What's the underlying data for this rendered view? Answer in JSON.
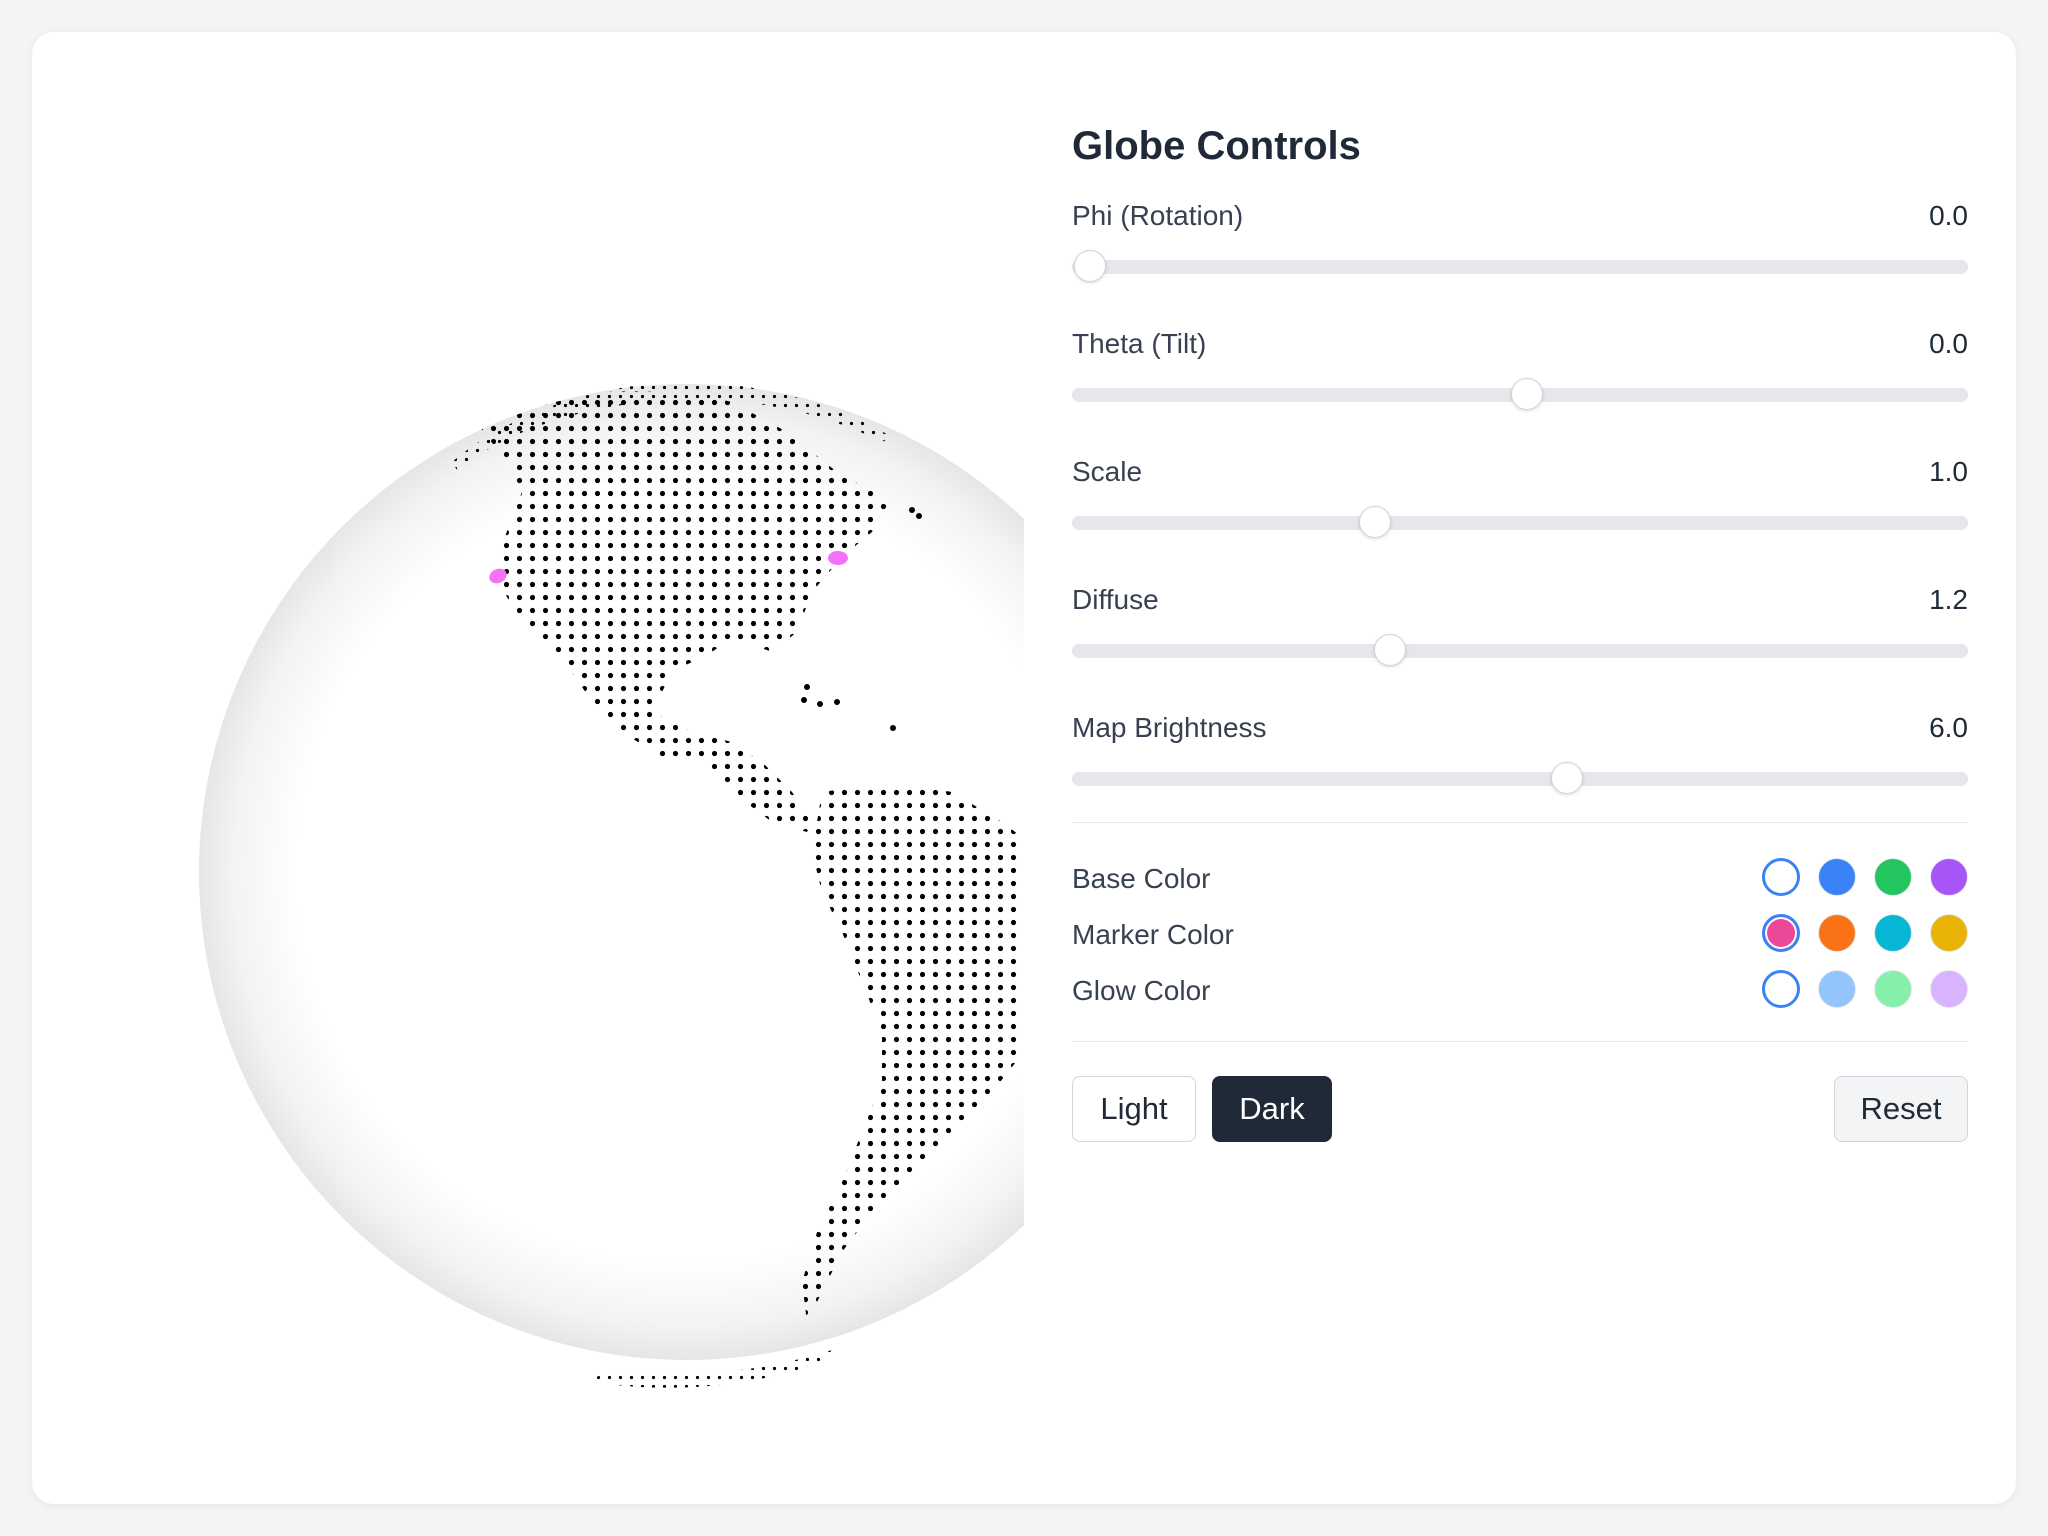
{
  "panel": {
    "title": "Globe Controls"
  },
  "sliders": [
    {
      "label": "Phi (Rotation)",
      "value": "0.0",
      "position": 0.02
    },
    {
      "label": "Theta (Tilt)",
      "value": "0.0",
      "position": 0.508
    },
    {
      "label": "Scale",
      "value": "1.0",
      "position": 0.338
    },
    {
      "label": "Diffuse",
      "value": "1.2",
      "position": 0.355
    },
    {
      "label": "Map Brightness",
      "value": "6.0",
      "position": 0.553
    }
  ],
  "colors": {
    "base": {
      "label": "Base Color",
      "options": [
        "#ffffff",
        "#3b82f6",
        "#22c55e",
        "#a855f7"
      ],
      "selected": 0
    },
    "marker": {
      "label": "Marker Color",
      "options": [
        "#ec4899",
        "#f97316",
        "#06b6d4",
        "#eab308"
      ],
      "selected": 0
    },
    "glow": {
      "label": "Glow Color",
      "options": [
        "#ffffff",
        "#93c5fd",
        "#86efac",
        "#d8b4fe"
      ],
      "selected": 0
    }
  },
  "buttons": {
    "light": "Light",
    "dark": "Dark",
    "reset": "Reset"
  },
  "globe": {
    "dot_color": "#000000",
    "marker_color": "#f472f6"
  }
}
